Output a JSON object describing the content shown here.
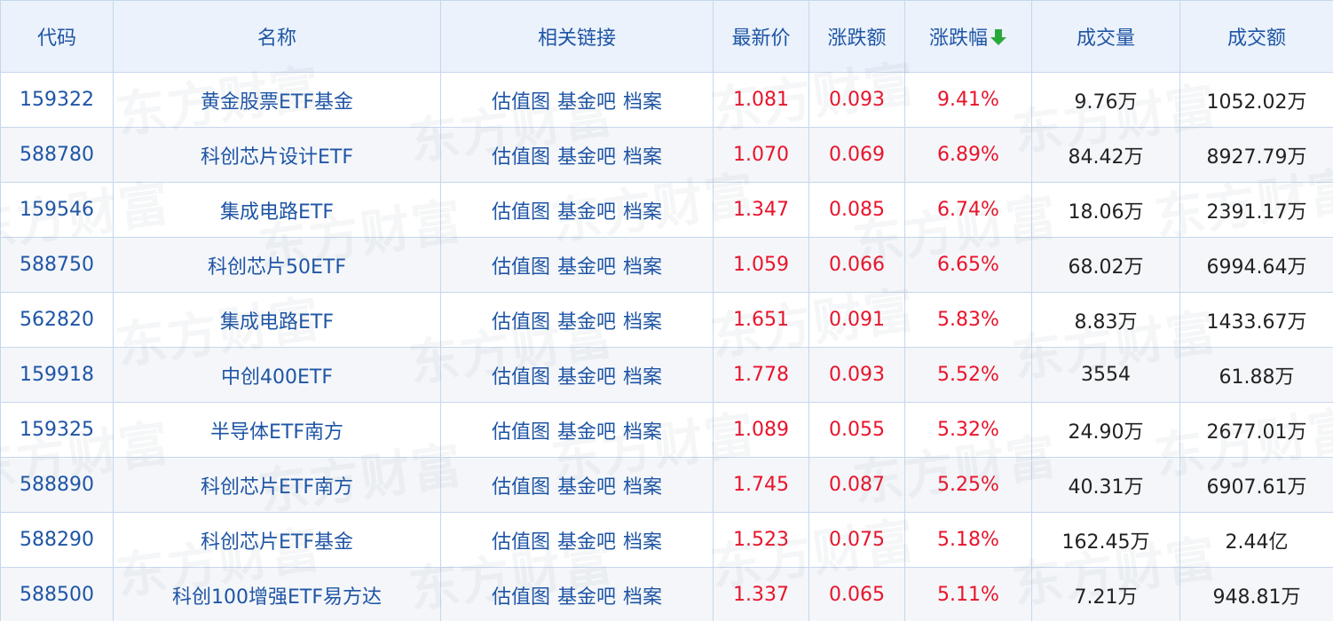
{
  "colors": {
    "header_bg": "#ebf2fb",
    "link_blue": "#1f55a5",
    "up_red": "#e8142b",
    "sort_arrow_green": "#2aa93b"
  },
  "watermark_text": "东方财富",
  "headers": {
    "code": "代码",
    "name": "名称",
    "links": "相关链接",
    "price": "最新价",
    "change": "涨跌额",
    "pct": "涨跌幅",
    "volume": "成交量",
    "amount": "成交额"
  },
  "sort": {
    "column": "涨跌幅",
    "direction": "desc",
    "icon": "arrow-down-icon"
  },
  "link_labels": [
    "估值图",
    "基金吧",
    "档案"
  ],
  "rows": [
    {
      "code": "159322",
      "name": "黄金股票ETF基金",
      "price": "1.081",
      "change": "0.093",
      "pct": "9.41%",
      "volume": "9.76万",
      "amount": "1052.02万"
    },
    {
      "code": "588780",
      "name": "科创芯片设计ETF",
      "price": "1.070",
      "change": "0.069",
      "pct": "6.89%",
      "volume": "84.42万",
      "amount": "8927.79万"
    },
    {
      "code": "159546",
      "name": "集成电路ETF",
      "price": "1.347",
      "change": "0.085",
      "pct": "6.74%",
      "volume": "18.06万",
      "amount": "2391.17万"
    },
    {
      "code": "588750",
      "name": "科创芯片50ETF",
      "price": "1.059",
      "change": "0.066",
      "pct": "6.65%",
      "volume": "68.02万",
      "amount": "6994.64万"
    },
    {
      "code": "562820",
      "name": "集成电路ETF",
      "price": "1.651",
      "change": "0.091",
      "pct": "5.83%",
      "volume": "8.83万",
      "amount": "1433.67万"
    },
    {
      "code": "159918",
      "name": "中创400ETF",
      "price": "1.778",
      "change": "0.093",
      "pct": "5.52%",
      "volume": "3554",
      "amount": "61.88万"
    },
    {
      "code": "159325",
      "name": "半导体ETF南方",
      "price": "1.089",
      "change": "0.055",
      "pct": "5.32%",
      "volume": "24.90万",
      "amount": "2677.01万"
    },
    {
      "code": "588890",
      "name": "科创芯片ETF南方",
      "price": "1.745",
      "change": "0.087",
      "pct": "5.25%",
      "volume": "40.31万",
      "amount": "6907.61万"
    },
    {
      "code": "588290",
      "name": "科创芯片ETF基金",
      "price": "1.523",
      "change": "0.075",
      "pct": "5.18%",
      "volume": "162.45万",
      "amount": "2.44亿"
    },
    {
      "code": "588500",
      "name": "科创100增强ETF易方达",
      "price": "1.337",
      "change": "0.065",
      "pct": "5.11%",
      "volume": "7.21万",
      "amount": "948.81万"
    }
  ]
}
